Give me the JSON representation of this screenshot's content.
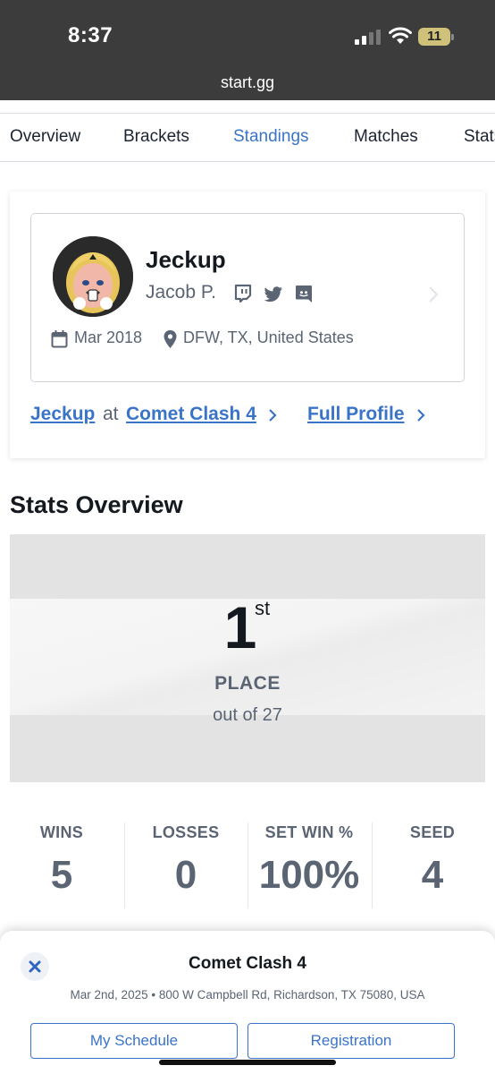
{
  "status": {
    "time": "8:37",
    "battery": "11",
    "url": "start.gg"
  },
  "tabs": [
    "Overview",
    "Brackets",
    "Standings",
    "Matches",
    "Stats"
  ],
  "active_tab": "Standings",
  "player": {
    "gamer_tag": "Jeckup",
    "real_name": "Jacob P.",
    "socials": [
      "twitch-icon",
      "twitter-icon",
      "discord-icon"
    ],
    "joined": "Mar 2018",
    "location": "DFW, TX, United States"
  },
  "links": {
    "player_name": "Jeckup",
    "at": "at",
    "event": "Comet Clash 4",
    "full_profile": "Full Profile"
  },
  "stats": {
    "title": "Stats Overview",
    "place": "1",
    "place_suffix": "st",
    "place_label": "PLACE",
    "out_of": "out of 27",
    "columns": [
      {
        "label": "WINS",
        "value": "5"
      },
      {
        "label": "LOSSES",
        "value": "0"
      },
      {
        "label": "SET WIN %",
        "value": "100%"
      },
      {
        "label": "SEED",
        "value": "4"
      }
    ]
  },
  "sheet": {
    "event_name": "Comet Clash 4",
    "event_meta": "Mar 2nd, 2025 • 800 W Campbell Rd, Richardson, TX 75080, USA",
    "my_schedule": "My Schedule",
    "registration": "Registration"
  },
  "colors": {
    "accent": "#3a74c9",
    "text_dark": "#14181f",
    "text_muted": "#5b6473",
    "top_bar": "#3c3c3c"
  }
}
